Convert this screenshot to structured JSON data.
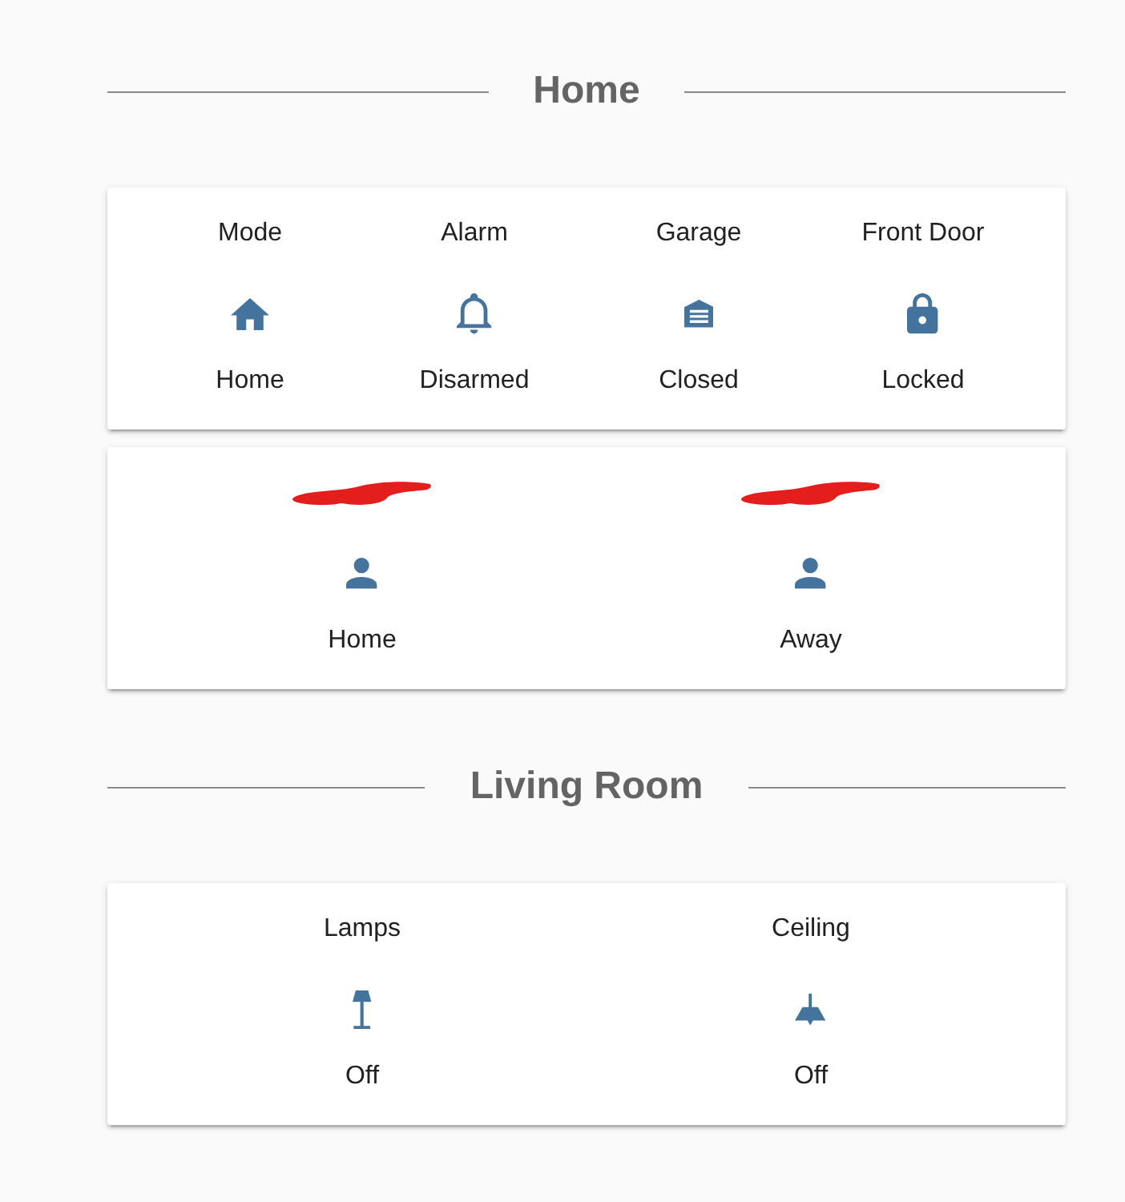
{
  "sections": [
    {
      "title": "Home",
      "cards": [
        {
          "tiles": [
            {
              "name": "Mode",
              "kind": "mode",
              "state": "Home"
            },
            {
              "name": "Alarm",
              "kind": "alarm",
              "state": "Disarmed"
            },
            {
              "name": "Garage",
              "kind": "garage",
              "state": "Closed"
            },
            {
              "name": "Front Door",
              "kind": "lock",
              "state": "Locked"
            }
          ]
        },
        {
          "tiles": [
            {
              "redacted": true,
              "kind": "person",
              "state": "Home"
            },
            {
              "redacted": true,
              "kind": "person",
              "state": "Away"
            }
          ]
        }
      ]
    },
    {
      "title": "Living Room",
      "cards": [
        {
          "tiles": [
            {
              "name": "Lamps",
              "kind": "lamp",
              "state": "Off"
            },
            {
              "name": "Ceiling",
              "kind": "ceiling-light",
              "state": "Off"
            }
          ]
        }
      ]
    }
  ]
}
